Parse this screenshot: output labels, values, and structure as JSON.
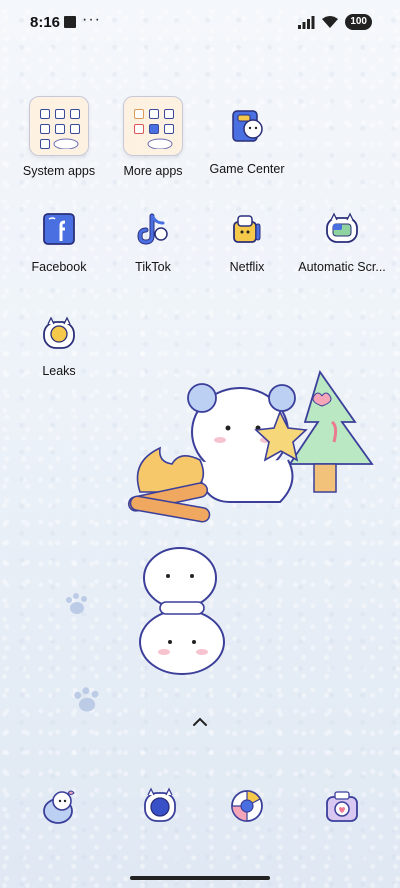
{
  "status": {
    "time": "8:16",
    "dots": "···",
    "battery": "100"
  },
  "apps": [
    {
      "id": "system-apps",
      "label": "System apps"
    },
    {
      "id": "more-apps",
      "label": "More apps"
    },
    {
      "id": "game-center",
      "label": "Game Center"
    },
    {
      "id": "facebook",
      "label": "Facebook"
    },
    {
      "id": "tiktok",
      "label": "TikTok"
    },
    {
      "id": "netflix",
      "label": "Netflix"
    },
    {
      "id": "automatic-scr",
      "label": "Automatic Scr..."
    },
    {
      "id": "leaks",
      "label": "Leaks"
    }
  ],
  "dock": [
    {
      "id": "phone",
      "icon": "cat-phone-icon"
    },
    {
      "id": "messages",
      "icon": "blue-bubble-icon"
    },
    {
      "id": "browser",
      "icon": "browser-icon"
    },
    {
      "id": "camera",
      "icon": "camera-icon"
    }
  ],
  "colors": {
    "icon_stroke": "#3b3f9a",
    "accent_yellow": "#f6c94a",
    "accent_blue": "#4a6fe0"
  }
}
